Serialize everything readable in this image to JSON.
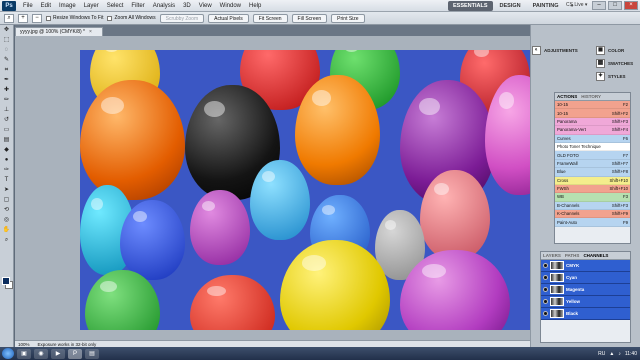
{
  "menubar": {
    "logo": "Ps",
    "items": [
      "File",
      "Edit",
      "Image",
      "Layer",
      "Select",
      "Filter",
      "Analysis",
      "3D",
      "View",
      "Window",
      "Help"
    ],
    "workspaces": [
      "ESSENTIALS",
      "DESIGN",
      "PAINTING",
      "»"
    ],
    "cs_live": "CS Live ▾"
  },
  "options": {
    "resize_windows": "Resize Windows To Fit",
    "zoom_all": "Zoom All Windows",
    "scrubby": "Scrubby Zoom",
    "actual_pixels": "Actual Pixels",
    "fit_screen": "Fit Screen",
    "fill_screen": "Fill Screen",
    "print_size": "Print Size"
  },
  "document": {
    "tab_title": "yyyy.jpg @ 100% (CMYK/8) *",
    "zoom_readout": "100%",
    "status_message": "Exposure works in 32-bit only"
  },
  "panels": {
    "adjustments": "ADJUSTMENTS",
    "color": "COLOR",
    "swatches": "SWATCHES",
    "styles": "STYLES"
  },
  "actions_panel": {
    "tabs": [
      "ACTIONS",
      "HISTORY"
    ],
    "items": [
      {
        "name": "10-15",
        "key": "F2",
        "color": "#f2a28e"
      },
      {
        "name": "10-15",
        "key": "Shift+F2",
        "color": "#f2a28e"
      },
      {
        "name": "Panorama",
        "key": "Shift+F3",
        "color": "#f0a8d8"
      },
      {
        "name": "Panorama-Vert",
        "key": "Shift+F4",
        "color": "#f0a8d8"
      },
      {
        "name": "Curves",
        "key": "F6",
        "color": "#b6d4f0"
      },
      {
        "name": "Photo Toner Technique",
        "key": "",
        "color": "#ffffff"
      },
      {
        "name": "OLD FOTO",
        "key": "F7",
        "color": "#b6d4f0"
      },
      {
        "name": "FrameWall",
        "key": "Shift+F7",
        "color": "#b6d4f0"
      },
      {
        "name": "Blue",
        "key": "Shift+F8",
        "color": "#b6d4f0"
      },
      {
        "name": "Cross",
        "key": "Shift+F10",
        "color": "#f4ee8c"
      },
      {
        "name": "FWSh",
        "key": "Shift+F10",
        "color": "#f2a28e"
      },
      {
        "name": "WB",
        "key": "F3",
        "color": "#b6e0b0"
      },
      {
        "name": "B-Channels",
        "key": "Shift+F3",
        "color": "#b6d4f0"
      },
      {
        "name": "K-Channels",
        "key": "Shift+F9",
        "color": "#f2a28e"
      },
      {
        "name": "Paint-Auto",
        "key": "F9",
        "color": "#b6d4f0"
      }
    ]
  },
  "channels_panel": {
    "tabs": [
      "LAYERS",
      "PATHS",
      "CHANNELS"
    ],
    "rows": [
      "CMYK",
      "Cyan",
      "Magenta",
      "Yellow",
      "Black"
    ]
  },
  "taskbar": {
    "language": "RU",
    "time": "11:40"
  }
}
